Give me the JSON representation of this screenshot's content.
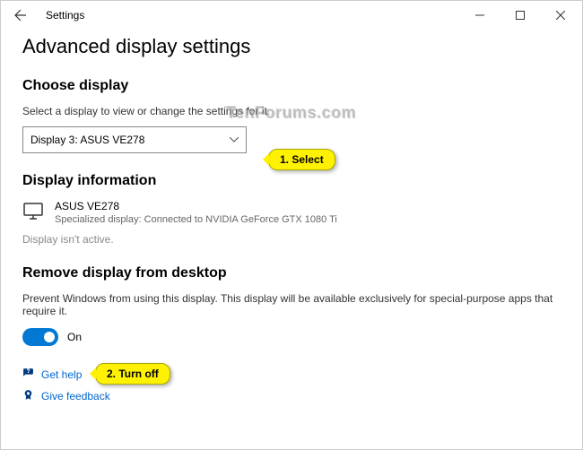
{
  "window": {
    "title": "Settings"
  },
  "page": {
    "title": "Advanced display settings"
  },
  "choose_display": {
    "heading": "Choose display",
    "help": "Select a display to view or change the settings for it.",
    "selected": "Display 3: ASUS VE278"
  },
  "display_info": {
    "heading": "Display information",
    "name": "ASUS VE278",
    "desc": "Specialized display: Connected to NVIDIA GeForce GTX 1080 Ti",
    "inactive": "Display isn't active."
  },
  "remove_display": {
    "heading": "Remove display from desktop",
    "desc": "Prevent Windows from using this display. This display will be available exclusively for special-purpose apps that require it.",
    "toggle_label": "On"
  },
  "footer": {
    "help": "Get help",
    "feedback": "Give feedback"
  },
  "callouts": {
    "c1": "1.  Select",
    "c2": "2.  Turn off"
  },
  "watermark": "TenForums.com"
}
